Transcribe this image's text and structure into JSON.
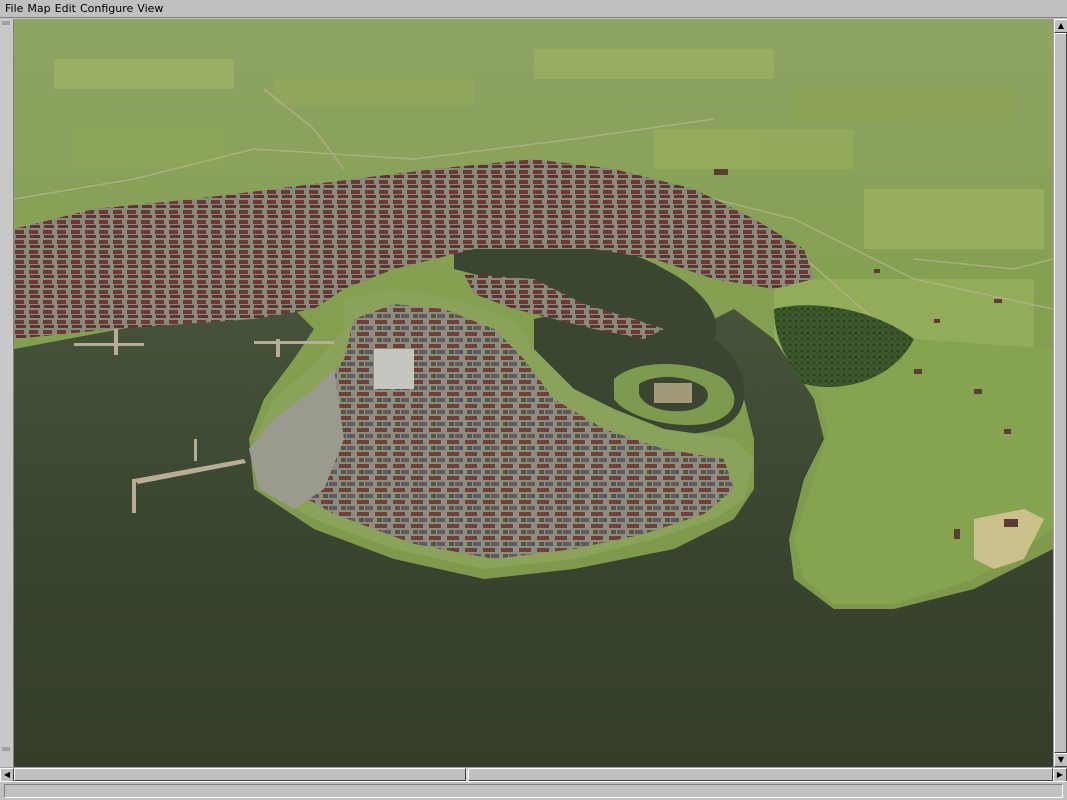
{
  "menu": {
    "items": [
      {
        "label": "File"
      },
      {
        "label": "Map"
      },
      {
        "label": "Edit"
      },
      {
        "label": "Configure"
      },
      {
        "label": "View"
      }
    ]
  },
  "scrollbar": {
    "up_icon": "arrow-up-icon",
    "down_icon": "arrow-down-icon",
    "left_icon": "arrow-left-icon",
    "right_icon": "arrow-right-icon",
    "up_glyph": "▲",
    "down_glyph": "▼",
    "left_glyph": "◀",
    "right_glyph": "▶"
  },
  "status": {
    "text": ""
  },
  "scene": {
    "description_colors": {
      "water": "#3a4530",
      "land": "#7e9a4a",
      "field": "#9ab25c",
      "town_roof": "#6a3a34",
      "road": "#9a9a8a"
    }
  }
}
